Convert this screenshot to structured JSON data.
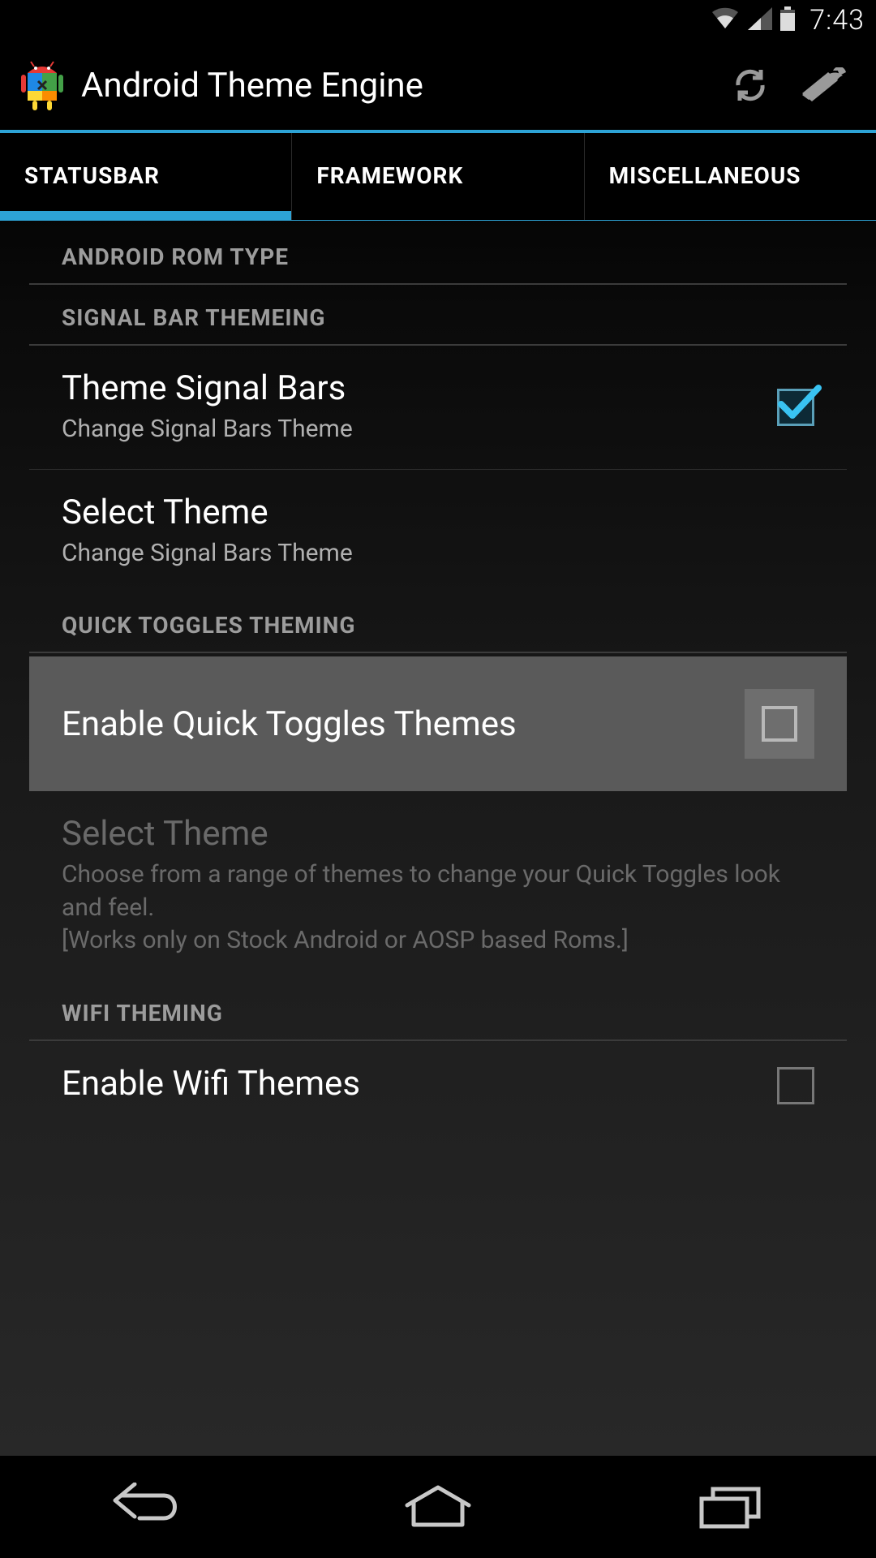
{
  "status": {
    "time": "7:43"
  },
  "header": {
    "title": "Android Theme Engine"
  },
  "tabs": [
    {
      "label": "STATUSBAR",
      "active": true
    },
    {
      "label": "FRAMEWORK",
      "active": false
    },
    {
      "label": "MISCELLANEOUS",
      "active": false
    }
  ],
  "sections": {
    "rom_type": {
      "header": "ANDROID ROM TYPE"
    },
    "signal_bar": {
      "header": "SIGNAL BAR THEMEING",
      "theme_signal_bars": {
        "title": "Theme Signal Bars",
        "summary": "Change Signal Bars Theme",
        "checked": true
      },
      "select_theme": {
        "title": "Select Theme",
        "summary": "Change Signal Bars Theme"
      }
    },
    "quick_toggles": {
      "header": "QUICK TOGGLES THEMING",
      "enable": {
        "title": "Enable Quick Toggles Themes",
        "checked": false
      },
      "select_theme": {
        "title": "Select Theme",
        "summary": "Choose from a range of themes to change your Quick Toggles look and feel.\n[Works only on Stock Android or AOSP based Roms.]"
      }
    },
    "wifi": {
      "header": "WIFI THEMING",
      "enable": {
        "title": "Enable Wifi Themes",
        "checked": false
      }
    }
  }
}
